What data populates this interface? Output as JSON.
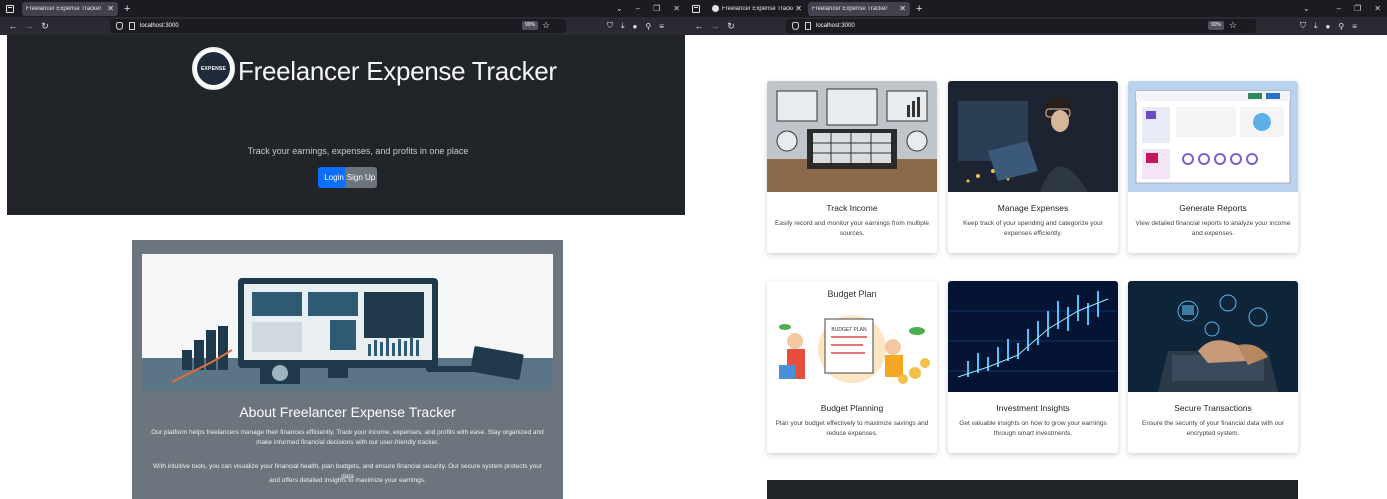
{
  "left_window": {
    "tab": {
      "title": "Freelancer Expense Tracker"
    },
    "new_tab": "+",
    "url": "localhost:3000",
    "zoom": "90%",
    "hero": {
      "title": "Freelancer Expense Tracker",
      "subtitle": "Track your earnings, expenses, and profits in one place",
      "login_label": "Login",
      "signup_label": "Sign Up",
      "logo_text": "EXPENSE"
    },
    "about": {
      "title": "About Freelancer Expense Tracker",
      "p1_line1": "Our platform helps freelancers manage their finances efficiently. Track your income, expenses, and profits with ease. Stay organized and",
      "p1_line2": "make informed financial decisions with our user-friendly tracker.",
      "p2_line1": "With intuitive tools, you can visualize your financial health, plan budgets, and ensure financial security. Our secure system protects your data",
      "p2_line2": "and offers detailed insights to maximize your earnings."
    }
  },
  "right_window": {
    "tabs": [
      {
        "title": "Freelancer Expense Tracker Atm"
      },
      {
        "title": "Freelancer Expense Tracker"
      }
    ],
    "new_tab": "+",
    "url": "localhost:3000",
    "zoom": "90%",
    "cards": [
      {
        "title": "Track Income",
        "line1": "Easily record and monitor your earnings from multiple",
        "line2": "sources."
      },
      {
        "title": "Manage Expenses",
        "line1": "Keep track of your spending and categorize your",
        "line2": "expenses efficiently."
      },
      {
        "title": "Generate Reports",
        "line1": "View detailed financial reports to analyze your income",
        "line2": "and expenses."
      },
      {
        "title": "Budget Planning",
        "line1": "Plan your budget effectively to maximize savings and",
        "line2": "reduce expenses.",
        "img_label": "Budget Plan",
        "img_inner_label": "BUDGET PLAN"
      },
      {
        "title": "Investment Insights",
        "line1": "Get valuable insights on how to grow your earnings",
        "line2": "through smart investments."
      },
      {
        "title": "Secure Transactions",
        "line1": "Ensure the security of your financial data with our",
        "line2": "encrypted system."
      }
    ]
  },
  "colors": {
    "hero_bg": "#212529",
    "about_bg": "#6c757d",
    "login_btn": "#0d6efd",
    "signup_btn": "#6c757d",
    "browser_chrome": "#1c1b22"
  }
}
